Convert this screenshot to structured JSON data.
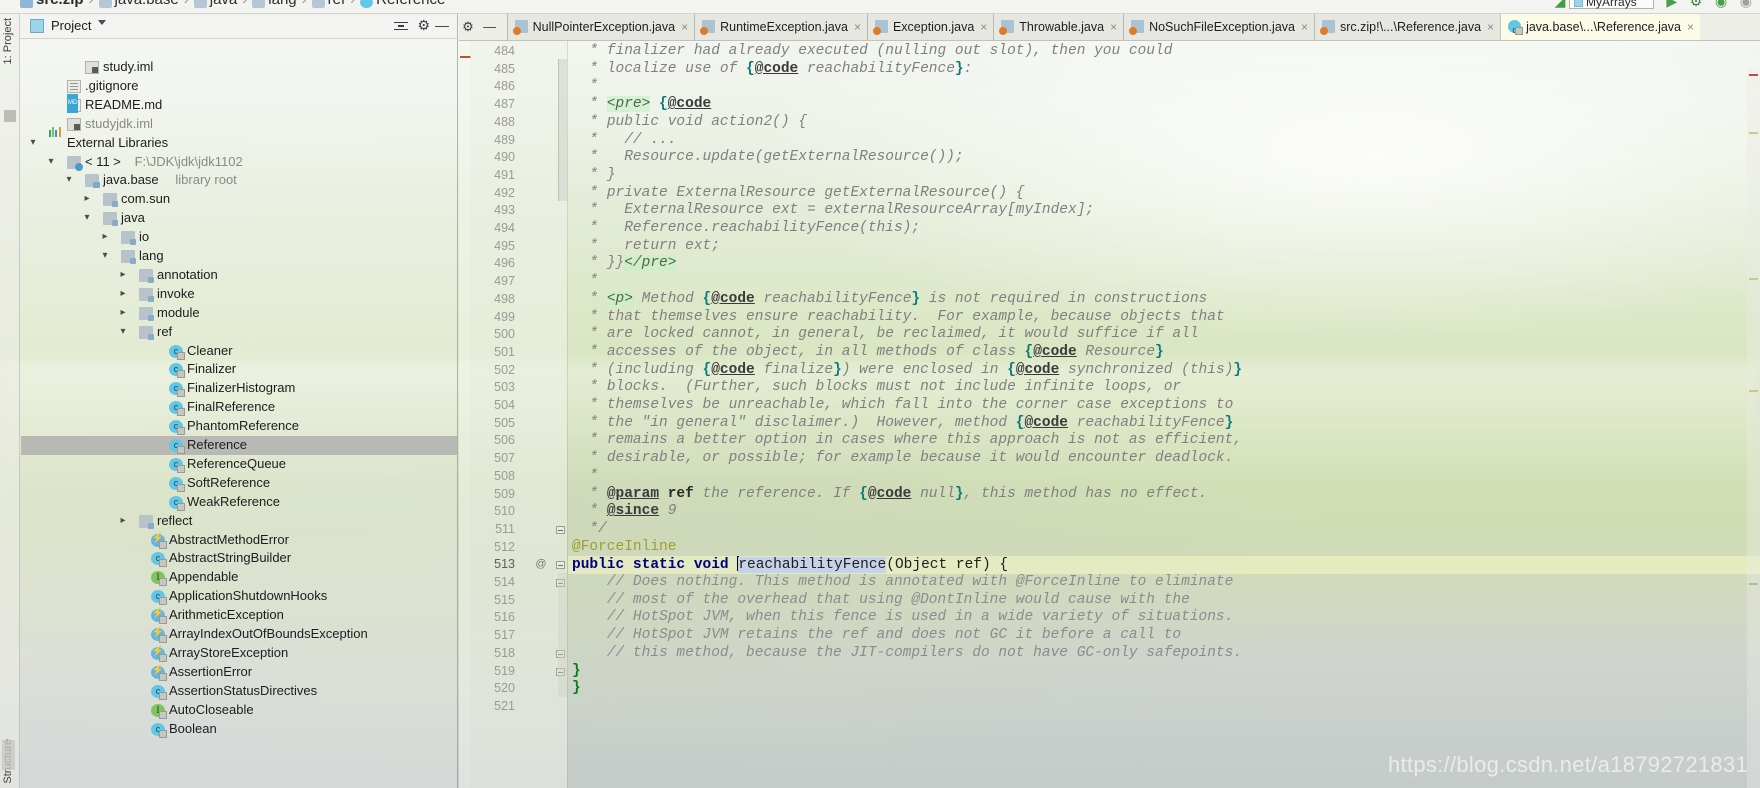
{
  "breadcrumb": {
    "items": [
      {
        "label": "src.zip",
        "icon": "zip-icon",
        "bold": true
      },
      {
        "label": "java.base",
        "icon": "folder-icon",
        "bold": false
      },
      {
        "label": "java",
        "icon": "folder-icon",
        "bold": false
      },
      {
        "label": "lang",
        "icon": "folder-icon",
        "bold": false
      },
      {
        "label": "ref",
        "icon": "folder-icon",
        "bold": false
      },
      {
        "label": "Reference",
        "icon": "class-icon",
        "bold": false
      }
    ],
    "separator": "›"
  },
  "toolbar": {
    "run_configuration": "MyArrays",
    "run_label": "▶",
    "debug_label": "⚙",
    "run_coverage_label": "▶",
    "profile_label": "▶"
  },
  "sidebar": {
    "rail_top_label": "1: Project",
    "rail_bottom_label": "Structure",
    "panel_title": "Project",
    "collapse_all_tooltip": "Collapse All",
    "settings_icon": "gear-icon",
    "minimize_icon": "minimize-icon",
    "tree": [
      {
        "label": "study.iml",
        "sub": "",
        "indent": 64,
        "icon": "iml",
        "arrow": "",
        "selected": false
      },
      {
        "label": ".gitignore",
        "sub": "",
        "indent": 46,
        "icon": "gitignore",
        "arrow": "",
        "selected": false
      },
      {
        "label": "README.md",
        "sub": "",
        "indent": 46,
        "icon": "md",
        "arrow": "",
        "selected": false
      },
      {
        "label": "studyjdk.iml",
        "sub": "",
        "indent": 46,
        "icon": "iml",
        "arrow": "",
        "selected": false,
        "dim": true
      },
      {
        "label": "External Libraries",
        "sub": "",
        "indent": 28,
        "icon": "lib",
        "arrow": "v",
        "selected": false
      },
      {
        "label": "< 11 >",
        "sub": "F:\\JDK\\jdk\\jdk1102",
        "indent": 46,
        "icon": "jdk",
        "arrow": "v",
        "selected": false
      },
      {
        "label": "java.base",
        "sub": "library root",
        "indent": 64,
        "icon": "folder",
        "arrow": "v",
        "selected": false
      },
      {
        "label": "com.sun",
        "sub": "",
        "indent": 82,
        "icon": "pkg",
        "arrow": ">",
        "selected": false
      },
      {
        "label": "java",
        "sub": "",
        "indent": 82,
        "icon": "pkg",
        "arrow": "v",
        "selected": false
      },
      {
        "label": "io",
        "sub": "",
        "indent": 100,
        "icon": "pkg",
        "arrow": ">",
        "selected": false
      },
      {
        "label": "lang",
        "sub": "",
        "indent": 100,
        "icon": "pkg",
        "arrow": "v",
        "selected": false
      },
      {
        "label": "annotation",
        "sub": "",
        "indent": 118,
        "icon": "pkg",
        "arrow": ">",
        "selected": false
      },
      {
        "label": "invoke",
        "sub": "",
        "indent": 118,
        "icon": "pkg",
        "arrow": ">",
        "selected": false
      },
      {
        "label": "module",
        "sub": "",
        "indent": 118,
        "icon": "pkg",
        "arrow": ">",
        "selected": false
      },
      {
        "label": "ref",
        "sub": "",
        "indent": 118,
        "icon": "pkg",
        "arrow": "v",
        "selected": false
      },
      {
        "label": "Cleaner",
        "sub": "",
        "indent": 148,
        "icon": "cls",
        "arrow": "",
        "selected": false
      },
      {
        "label": "Finalizer",
        "sub": "",
        "indent": 148,
        "icon": "cls",
        "arrow": "",
        "selected": false
      },
      {
        "label": "FinalizerHistogram",
        "sub": "",
        "indent": 148,
        "icon": "cls",
        "arrow": "",
        "selected": false
      },
      {
        "label": "FinalReference",
        "sub": "",
        "indent": 148,
        "icon": "cls",
        "arrow": "",
        "selected": false
      },
      {
        "label": "PhantomReference",
        "sub": "",
        "indent": 148,
        "icon": "cls",
        "arrow": "",
        "selected": false
      },
      {
        "label": "Reference",
        "sub": "",
        "indent": 148,
        "icon": "cls",
        "arrow": "",
        "selected": true
      },
      {
        "label": "ReferenceQueue",
        "sub": "",
        "indent": 148,
        "icon": "cls",
        "arrow": "",
        "selected": false
      },
      {
        "label": "SoftReference",
        "sub": "",
        "indent": 148,
        "icon": "cls",
        "arrow": "",
        "selected": false
      },
      {
        "label": "WeakReference",
        "sub": "",
        "indent": 148,
        "icon": "cls",
        "arrow": "",
        "selected": false
      },
      {
        "label": "reflect",
        "sub": "",
        "indent": 118,
        "icon": "pkg",
        "arrow": ">",
        "selected": false
      },
      {
        "label": "AbstractMethodError",
        "sub": "",
        "indent": 130,
        "icon": "exc",
        "arrow": "",
        "selected": false
      },
      {
        "label": "AbstractStringBuilder",
        "sub": "",
        "indent": 130,
        "icon": "cls",
        "arrow": "",
        "selected": false
      },
      {
        "label": "Appendable",
        "sub": "",
        "indent": 130,
        "icon": "iface",
        "arrow": "",
        "selected": false
      },
      {
        "label": "ApplicationShutdownHooks",
        "sub": "",
        "indent": 130,
        "icon": "cls",
        "arrow": "",
        "selected": false
      },
      {
        "label": "ArithmeticException",
        "sub": "",
        "indent": 130,
        "icon": "exc",
        "arrow": "",
        "selected": false
      },
      {
        "label": "ArrayIndexOutOfBoundsException",
        "sub": "",
        "indent": 130,
        "icon": "exc",
        "arrow": "",
        "selected": false
      },
      {
        "label": "ArrayStoreException",
        "sub": "",
        "indent": 130,
        "icon": "exc",
        "arrow": "",
        "selected": false
      },
      {
        "label": "AssertionError",
        "sub": "",
        "indent": 130,
        "icon": "exc",
        "arrow": "",
        "selected": false
      },
      {
        "label": "AssertionStatusDirectives",
        "sub": "",
        "indent": 130,
        "icon": "cls",
        "arrow": "",
        "selected": false
      },
      {
        "label": "AutoCloseable",
        "sub": "",
        "indent": 130,
        "icon": "iface",
        "arrow": "",
        "selected": false
      },
      {
        "label": "Boolean",
        "sub": "",
        "indent": 130,
        "icon": "cls",
        "arrow": "",
        "selected": false
      }
    ]
  },
  "editor": {
    "tabs": [
      {
        "label": "NullPointerException.java",
        "icon": "java-file-icon",
        "active": false
      },
      {
        "label": "RuntimeException.java",
        "icon": "java-file-icon",
        "active": false
      },
      {
        "label": "Exception.java",
        "icon": "java-file-icon",
        "active": false
      },
      {
        "label": "Throwable.java",
        "icon": "java-file-icon",
        "active": false
      },
      {
        "label": "NoSuchFileException.java",
        "icon": "java-file-icon",
        "active": false
      },
      {
        "label": "src.zip!\\...\\Reference.java",
        "icon": "java-file-icon",
        "active": false
      },
      {
        "label": "java.base\\...\\Reference.java",
        "icon": "java-class-icon",
        "active": true
      }
    ],
    "close_glyph": "×",
    "first_line_number": 484,
    "current_line_number": 513,
    "gutter_annotation_marker": "@",
    "caret_word_selection": "reachabilityFence",
    "lines": [
      {
        "n": 484,
        "html": "<span class=\"asterisk\">  * </span>finalizer had already executed (nulling out slot), then you could"
      },
      {
        "n": 485,
        "html": "<span class=\"asterisk\">  * </span>localize use of <span class=\"jdbrace\">{</span><span class=\"jdtag\">@code</span> reachabilityFence<span class=\"jdbrace\">}</span>:"
      },
      {
        "n": 486,
        "html": "<span class=\"asterisk\">  *</span>"
      },
      {
        "n": 487,
        "html": "<span class=\"asterisk\">  * </span><span class=\"htmltag\">&lt;pre&gt;</span> <span class=\"jdbrace\">{</span><span class=\"jdtag\">@code</span>"
      },
      {
        "n": 488,
        "html": "<span class=\"asterisk\">  * </span>public void action2() {"
      },
      {
        "n": 489,
        "html": "<span class=\"asterisk\">  * </span>  // ..."
      },
      {
        "n": 490,
        "html": "<span class=\"asterisk\">  * </span>  Resource.update(getExternalResource());"
      },
      {
        "n": 491,
        "html": "<span class=\"asterisk\">  * </span>}"
      },
      {
        "n": 492,
        "html": "<span class=\"asterisk\">  * </span>private ExternalResource getExternalResource() {"
      },
      {
        "n": 493,
        "html": "<span class=\"asterisk\">  * </span>  ExternalResource ext = externalResourceArray[myIndex];"
      },
      {
        "n": 494,
        "html": "<span class=\"asterisk\">  * </span>  Reference.reachabilityFence(this);"
      },
      {
        "n": 495,
        "html": "<span class=\"asterisk\">  * </span>  return ext;"
      },
      {
        "n": 496,
        "html": "<span class=\"asterisk\">  * </span>}}<span class=\"htmltag\">&lt;/pre&gt;</span>"
      },
      {
        "n": 497,
        "html": "<span class=\"asterisk\">  *</span>"
      },
      {
        "n": 498,
        "html": "<span class=\"asterisk\">  * </span><span class=\"htmltag\">&lt;p&gt;</span> Method <span class=\"jdbrace\">{</span><span class=\"jdtag\">@code</span> reachabilityFence<span class=\"jdbrace\">}</span> is not required in constructions"
      },
      {
        "n": 499,
        "html": "<span class=\"asterisk\">  * </span>that themselves ensure reachability.  For example, because objects that"
      },
      {
        "n": 500,
        "html": "<span class=\"asterisk\">  * </span>are locked cannot, in general, be reclaimed, it would suffice if all"
      },
      {
        "n": 501,
        "html": "<span class=\"asterisk\">  * </span>accesses of the object, in all methods of class <span class=\"jdbrace\">{</span><span class=\"jdtag\">@code</span> Resource<span class=\"jdbrace\">}</span>"
      },
      {
        "n": 502,
        "html": "<span class=\"asterisk\">  * </span>(including <span class=\"jdbrace\">{</span><span class=\"jdtag\">@code</span> finalize<span class=\"jdbrace\">}</span>) were enclosed in <span class=\"jdbrace\">{</span><span class=\"jdtag\">@code</span> synchronized (this)<span class=\"jdbrace\">}</span>"
      },
      {
        "n": 503,
        "html": "<span class=\"asterisk\">  * </span>blocks.  (Further, such blocks must not include infinite loops, or"
      },
      {
        "n": 504,
        "html": "<span class=\"asterisk\">  * </span>themselves be unreachable, which fall into the corner case exceptions to"
      },
      {
        "n": 505,
        "html": "<span class=\"asterisk\">  * </span>the \"in general\" disclaimer.)  However, method <span class=\"jdbrace\">{</span><span class=\"jdtag\">@code</span> reachabilityFence<span class=\"jdbrace\">}</span>"
      },
      {
        "n": 506,
        "html": "<span class=\"asterisk\">  * </span>remains a better option in cases where this approach is not as efficient,"
      },
      {
        "n": 507,
        "html": "<span class=\"asterisk\">  * </span>desirable, or possible; for example because it would encounter deadlock."
      },
      {
        "n": 508,
        "html": "<span class=\"asterisk\">  *</span>"
      },
      {
        "n": 509,
        "html": "<span class=\"asterisk\">  * </span><span class=\"jdtag\">@param</span> <span class=\"jdparam\">ref</span> the reference. If <span class=\"jdbrace\">{</span><span class=\"jdtag\">@code</span> null<span class=\"jdbrace\">}</span>, this method has no effect."
      },
      {
        "n": 510,
        "html": "<span class=\"asterisk\">  * </span><span class=\"jdtag\">@since</span> 9"
      },
      {
        "n": 511,
        "html": "<span class=\"asterisk\">  */</span>"
      },
      {
        "n": 512,
        "html": "<span class=\"anno\">@ForceInline</span>"
      },
      {
        "n": 513,
        "html": "<span class=\"kw\">public static void </span><span class=\"caret\"></span><span class=\"sel plain\">reachabilityFence</span><span class=\"plain\">(Object ref) {</span>"
      },
      {
        "n": 514,
        "html": "    <span class=\"linecomment\">// Does nothing. This method is annotated with @ForceInline to eliminate</span>"
      },
      {
        "n": 515,
        "html": "    <span class=\"linecomment\">// most of the overhead that using @DontInline would cause with the</span>"
      },
      {
        "n": 516,
        "html": "    <span class=\"linecomment\">// HotSpot JVM, when this fence is used in a wide variety of situations.</span>"
      },
      {
        "n": 517,
        "html": "    <span class=\"linecomment\">// HotSpot JVM retains the ref and does not GC it before a call to</span>"
      },
      {
        "n": 518,
        "html": "    <span class=\"linecomment\">// this method, because the JIT-compilers do not have GC-only safepoints.</span>"
      },
      {
        "n": 519,
        "html": "<span class=\"brace-green\">}</span>"
      },
      {
        "n": 520,
        "html": "<span class=\"brace-green\">}</span>"
      },
      {
        "n": 521,
        "html": ""
      }
    ],
    "plain_lines": [
      " * finalizer had already executed (nulling out slot), then you could",
      " * localize use of {@code reachabilityFence}:",
      " *",
      " * <pre> {@code",
      " * public void action2() {",
      " *   // ...",
      " *   Resource.update(getExternalResource());",
      " * }",
      " * private ExternalResource getExternalResource() {",
      " *   ExternalResource ext = externalResourceArray[myIndex];",
      " *   Reference.reachabilityFence(this);",
      " *   return ext;",
      " * }}</pre>",
      " *",
      " * <p> Method {@code reachabilityFence} is not required in constructions",
      " * that themselves ensure reachability.  For example, because objects that",
      " * are locked cannot, in general, be reclaimed, it would suffice if all",
      " * accesses of the object, in all methods of class {@code Resource}",
      " * (including {@code finalize}) were enclosed in {@code synchronized (this)}",
      " * blocks.  (Further, such blocks must not include infinite loops, or",
      " * themselves be unreachable, which fall into the corner case exceptions to",
      " * the \"in general\" disclaimer.)  However, method {@code reachabilityFence}",
      " * remains a better option in cases where this approach is not as efficient,",
      " * desirable, or possible; for example because it would encounter deadlock.",
      " *",
      " * @param ref the reference. If {@code null}, this method has no effect.",
      " * @since 9",
      " */",
      "@ForceInline",
      "public static void reachabilityFence(Object ref) {",
      "    // Does nothing. This method is annotated with @ForceInline to eliminate",
      "    // most of the overhead that using @DontInline would cause with the",
      "    // HotSpot JVM, when this fence is used in a wide variety of situations.",
      "    // HotSpot JVM retains the ref and does not GC it before a call to",
      "    // this method, because the JIT-compilers do not have GC-only safepoints.",
      "}",
      "}"
    ]
  },
  "watermark": {
    "text": "https://blog.csdn.net/a18792721831"
  },
  "colors": {
    "keyword": "#000080",
    "annotation": "#9e9e2e",
    "comment": "#808080",
    "javadoc_tag": "#3a3a3a",
    "selection": "#c5d3ea",
    "current_line": "#fffce0",
    "tree_selection": "#b4b4b2",
    "active_tab": "#fbfbe8"
  }
}
